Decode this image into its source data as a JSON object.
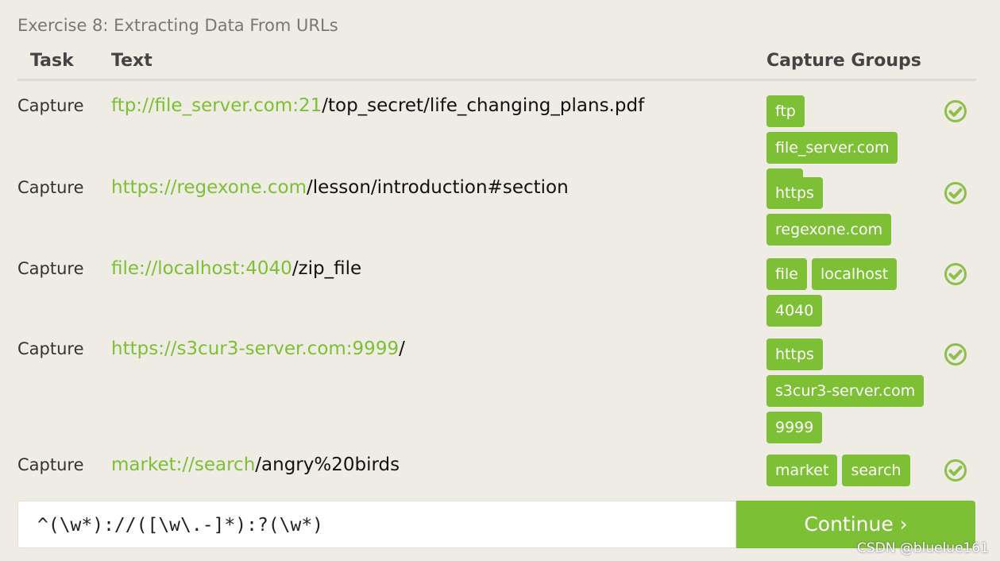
{
  "title": "Exercise 8: Extracting Data From URLs",
  "headers": {
    "task": "Task",
    "text": "Text",
    "groups": "Capture Groups"
  },
  "rows": [
    {
      "task": "Capture",
      "match": "ftp://file_server.com:21",
      "rest": "/top_secret/life_changing_plans.pdf",
      "groups": [
        "ftp",
        "file_server.com",
        "21"
      ],
      "status": "check-icon"
    },
    {
      "task": "Capture",
      "match": "https://regexone.com",
      "rest": "/lesson/introduction#section",
      "groups": [
        "https",
        "regexone.com"
      ],
      "status": "check-icon"
    },
    {
      "task": "Capture",
      "match": "file://localhost:4040",
      "rest": "/zip_file",
      "groups": [
        "file",
        "localhost",
        "4040"
      ],
      "status": "check-icon"
    },
    {
      "task": "Capture",
      "match": "https://s3cur3-server.com:9999",
      "rest": "/",
      "groups": [
        "https",
        "s3cur3-server.com",
        "9999"
      ],
      "status": "check-icon"
    },
    {
      "task": "Capture",
      "match": "market://search",
      "rest": "/angry%20birds",
      "groups": [
        "market",
        "search"
      ],
      "status": "check-icon"
    }
  ],
  "input": {
    "value": "^(\\w*)://([\\w\\.-]*):?(\\w*)"
  },
  "continue_label": "Continue ›",
  "watermark": "CSDN @bluelue161",
  "colors": {
    "accent": "#7dbf35",
    "background": "#efece6"
  }
}
